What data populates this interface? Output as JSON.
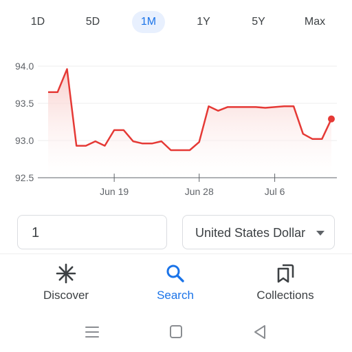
{
  "range_tabs": {
    "items": [
      "1D",
      "5D",
      "1M",
      "1Y",
      "5Y",
      "Max"
    ],
    "active": "1M"
  },
  "chart_data": {
    "type": "area",
    "y_ticks": [
      "94.0",
      "93.5",
      "93.0",
      "92.5"
    ],
    "ylim": [
      92.5,
      94.0
    ],
    "x_ticks": [
      "Jun 19",
      "Jun 28",
      "Jul 6"
    ],
    "x": [
      "Jun 12",
      "Jun 13",
      "Jun 14",
      "Jun 15",
      "Jun 16",
      "Jun 17",
      "Jun 18",
      "Jun 19",
      "Jun 20",
      "Jun 21",
      "Jun 22",
      "Jun 23",
      "Jun 24",
      "Jun 25",
      "Jun 26",
      "Jun 27",
      "Jun 28",
      "Jun 29",
      "Jun 30",
      "Jul 1",
      "Jul 2",
      "Jul 3",
      "Jul 4",
      "Jul 5",
      "Jul 6",
      "Jul 7",
      "Jul 8",
      "Jul 9",
      "Jul 10",
      "Jul 11",
      "Jul 12"
    ],
    "values": [
      93.65,
      93.65,
      93.96,
      92.93,
      92.93,
      92.99,
      92.93,
      93.14,
      93.14,
      92.99,
      92.96,
      92.96,
      92.99,
      92.87,
      92.87,
      92.87,
      92.98,
      93.46,
      93.4,
      93.45,
      93.45,
      93.45,
      93.45,
      93.44,
      93.45,
      93.46,
      93.46,
      93.09,
      93.02,
      93.02,
      93.29
    ],
    "line_color": "#e53935",
    "fill_color": "#fde2e1",
    "grid": true
  },
  "converter": {
    "amount": "1",
    "currency": "United States Dollar"
  },
  "nav": {
    "discover": "Discover",
    "search": "Search",
    "collections": "Collections",
    "active": "search",
    "accent": "#1a73e8"
  }
}
